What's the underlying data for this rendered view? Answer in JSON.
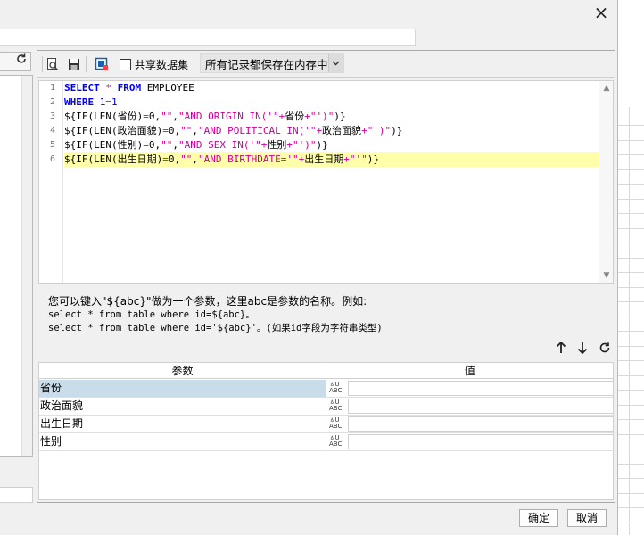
{
  "dialog": {
    "close_label": "×"
  },
  "toolbar": {
    "share_label": "共享数据集",
    "memory_select": "所有记录都保存在内存中"
  },
  "editor": {
    "line_numbers": [
      "1",
      "2",
      "3",
      "4",
      "5",
      "6"
    ],
    "active_line": 6
  },
  "hint": {
    "line1": "您可以键入\"${abc}\"做为一个参数，这里abc是参数的名称。例如:",
    "line2": "select * from table where id=${abc}。",
    "line3": "select * from table where id='${abc}'。(如果id字段为字符串类型)"
  },
  "params": {
    "header_param": "参数",
    "header_value": "值",
    "type_icon_text": "ABC",
    "rows": [
      {
        "name": "省份",
        "value": ""
      },
      {
        "name": "政治面貌",
        "value": ""
      },
      {
        "name": "出生日期",
        "value": ""
      },
      {
        "name": "性别",
        "value": ""
      }
    ],
    "selected_row": 0
  },
  "footer": {
    "ok_label": "确定",
    "cancel_label": "取消"
  },
  "colors": {
    "keyword": "#0000ff",
    "string": "#cc0099",
    "active_line": "#ffffaa",
    "selected_row": "#c8dcea"
  }
}
